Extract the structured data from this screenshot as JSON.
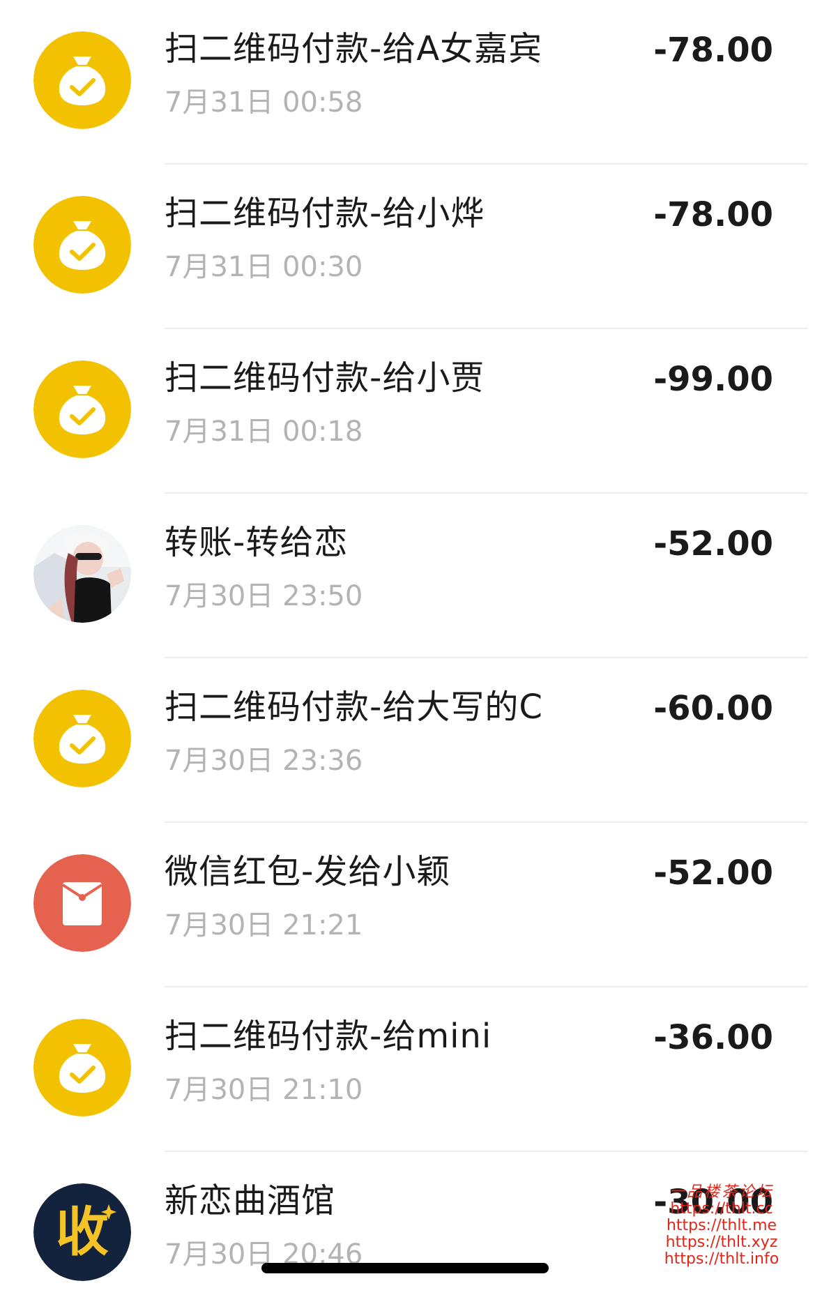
{
  "colors": {
    "qr_pay_icon_bg": "#F2C200",
    "red_packet_icon_bg": "#E5624F",
    "merchant_icon_bg": "#13223D",
    "merchant_icon_glyph": "#F5C325",
    "watermark": "#E0261A"
  },
  "transactions": [
    {
      "icon": "money-bag-check-icon",
      "title": "扫二维码付款-给A女嘉宾",
      "time": "7月31日 00:58",
      "amount": "-78.00"
    },
    {
      "icon": "money-bag-check-icon",
      "title": "扫二维码付款-给小烨",
      "time": "7月31日 00:30",
      "amount": "-78.00"
    },
    {
      "icon": "money-bag-check-icon",
      "title": "扫二维码付款-给小贾",
      "time": "7月31日 00:18",
      "amount": "-99.00"
    },
    {
      "icon": "user-avatar-photo",
      "title": "转账-转给恋",
      "time": "7月30日 23:50",
      "amount": "-52.00"
    },
    {
      "icon": "money-bag-check-icon",
      "title": "扫二维码付款-给大写的C",
      "time": "7月30日 23:36",
      "amount": "-60.00"
    },
    {
      "icon": "red-packet-icon",
      "title": "微信红包-发给小颖",
      "time": "7月30日 21:21",
      "amount": "-52.00"
    },
    {
      "icon": "money-bag-check-icon",
      "title": "扫二维码付款-给mini",
      "time": "7月30日 21:10",
      "amount": "-36.00"
    },
    {
      "icon": "merchant-collect-icon",
      "title": "新恋曲酒馆",
      "time": "7月30日 20:46",
      "amount": "-30.00"
    }
  ],
  "merchant_icon_char": "收",
  "watermark": {
    "title": "一品楼茶论坛",
    "urls": [
      "https://thlt.cc",
      "https://thlt.me",
      "https://thlt.xyz",
      "https://thlt.info"
    ]
  }
}
